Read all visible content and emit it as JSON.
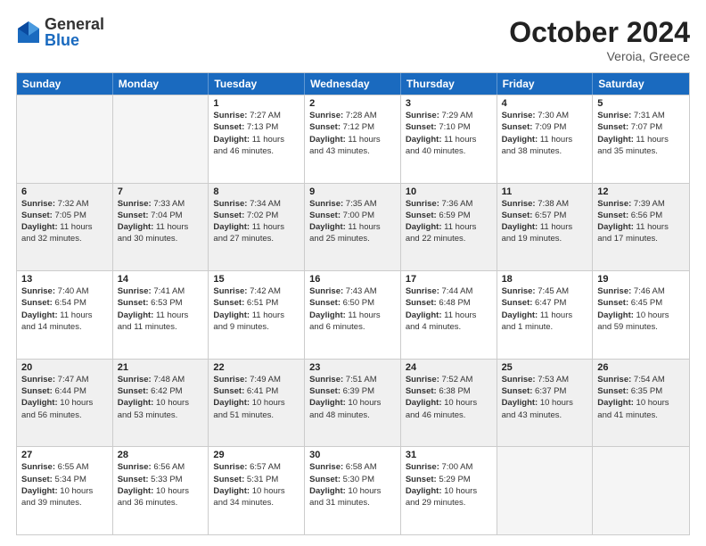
{
  "logo": {
    "general": "General",
    "blue": "Blue"
  },
  "header": {
    "month": "October 2024",
    "location": "Veroia, Greece"
  },
  "days": [
    "Sunday",
    "Monday",
    "Tuesday",
    "Wednesday",
    "Thursday",
    "Friday",
    "Saturday"
  ],
  "weeks": [
    [
      {
        "num": "",
        "empty": true
      },
      {
        "num": "",
        "empty": true
      },
      {
        "num": "1",
        "sunrise": "7:27 AM",
        "sunset": "7:13 PM",
        "daylight": "11 hours and 46 minutes."
      },
      {
        "num": "2",
        "sunrise": "7:28 AM",
        "sunset": "7:12 PM",
        "daylight": "11 hours and 43 minutes."
      },
      {
        "num": "3",
        "sunrise": "7:29 AM",
        "sunset": "7:10 PM",
        "daylight": "11 hours and 40 minutes."
      },
      {
        "num": "4",
        "sunrise": "7:30 AM",
        "sunset": "7:09 PM",
        "daylight": "11 hours and 38 minutes."
      },
      {
        "num": "5",
        "sunrise": "7:31 AM",
        "sunset": "7:07 PM",
        "daylight": "11 hours and 35 minutes."
      }
    ],
    [
      {
        "num": "6",
        "sunrise": "7:32 AM",
        "sunset": "7:05 PM",
        "daylight": "11 hours and 32 minutes.",
        "shaded": true
      },
      {
        "num": "7",
        "sunrise": "7:33 AM",
        "sunset": "7:04 PM",
        "daylight": "11 hours and 30 minutes.",
        "shaded": true
      },
      {
        "num": "8",
        "sunrise": "7:34 AM",
        "sunset": "7:02 PM",
        "daylight": "11 hours and 27 minutes.",
        "shaded": true
      },
      {
        "num": "9",
        "sunrise": "7:35 AM",
        "sunset": "7:00 PM",
        "daylight": "11 hours and 25 minutes.",
        "shaded": true
      },
      {
        "num": "10",
        "sunrise": "7:36 AM",
        "sunset": "6:59 PM",
        "daylight": "11 hours and 22 minutes.",
        "shaded": true
      },
      {
        "num": "11",
        "sunrise": "7:38 AM",
        "sunset": "6:57 PM",
        "daylight": "11 hours and 19 minutes.",
        "shaded": true
      },
      {
        "num": "12",
        "sunrise": "7:39 AM",
        "sunset": "6:56 PM",
        "daylight": "11 hours and 17 minutes.",
        "shaded": true
      }
    ],
    [
      {
        "num": "13",
        "sunrise": "7:40 AM",
        "sunset": "6:54 PM",
        "daylight": "11 hours and 14 minutes."
      },
      {
        "num": "14",
        "sunrise": "7:41 AM",
        "sunset": "6:53 PM",
        "daylight": "11 hours and 11 minutes."
      },
      {
        "num": "15",
        "sunrise": "7:42 AM",
        "sunset": "6:51 PM",
        "daylight": "11 hours and 9 minutes."
      },
      {
        "num": "16",
        "sunrise": "7:43 AM",
        "sunset": "6:50 PM",
        "daylight": "11 hours and 6 minutes."
      },
      {
        "num": "17",
        "sunrise": "7:44 AM",
        "sunset": "6:48 PM",
        "daylight": "11 hours and 4 minutes."
      },
      {
        "num": "18",
        "sunrise": "7:45 AM",
        "sunset": "6:47 PM",
        "daylight": "11 hours and 1 minute."
      },
      {
        "num": "19",
        "sunrise": "7:46 AM",
        "sunset": "6:45 PM",
        "daylight": "10 hours and 59 minutes."
      }
    ],
    [
      {
        "num": "20",
        "sunrise": "7:47 AM",
        "sunset": "6:44 PM",
        "daylight": "10 hours and 56 minutes.",
        "shaded": true
      },
      {
        "num": "21",
        "sunrise": "7:48 AM",
        "sunset": "6:42 PM",
        "daylight": "10 hours and 53 minutes.",
        "shaded": true
      },
      {
        "num": "22",
        "sunrise": "7:49 AM",
        "sunset": "6:41 PM",
        "daylight": "10 hours and 51 minutes.",
        "shaded": true
      },
      {
        "num": "23",
        "sunrise": "7:51 AM",
        "sunset": "6:39 PM",
        "daylight": "10 hours and 48 minutes.",
        "shaded": true
      },
      {
        "num": "24",
        "sunrise": "7:52 AM",
        "sunset": "6:38 PM",
        "daylight": "10 hours and 46 minutes.",
        "shaded": true
      },
      {
        "num": "25",
        "sunrise": "7:53 AM",
        "sunset": "6:37 PM",
        "daylight": "10 hours and 43 minutes.",
        "shaded": true
      },
      {
        "num": "26",
        "sunrise": "7:54 AM",
        "sunset": "6:35 PM",
        "daylight": "10 hours and 41 minutes.",
        "shaded": true
      }
    ],
    [
      {
        "num": "27",
        "sunrise": "6:55 AM",
        "sunset": "5:34 PM",
        "daylight": "10 hours and 39 minutes."
      },
      {
        "num": "28",
        "sunrise": "6:56 AM",
        "sunset": "5:33 PM",
        "daylight": "10 hours and 36 minutes."
      },
      {
        "num": "29",
        "sunrise": "6:57 AM",
        "sunset": "5:31 PM",
        "daylight": "10 hours and 34 minutes."
      },
      {
        "num": "30",
        "sunrise": "6:58 AM",
        "sunset": "5:30 PM",
        "daylight": "10 hours and 31 minutes."
      },
      {
        "num": "31",
        "sunrise": "7:00 AM",
        "sunset": "5:29 PM",
        "daylight": "10 hours and 29 minutes."
      },
      {
        "num": "",
        "empty": true
      },
      {
        "num": "",
        "empty": true
      }
    ]
  ],
  "labels": {
    "sunrise": "Sunrise:",
    "sunset": "Sunset:",
    "daylight": "Daylight:"
  }
}
